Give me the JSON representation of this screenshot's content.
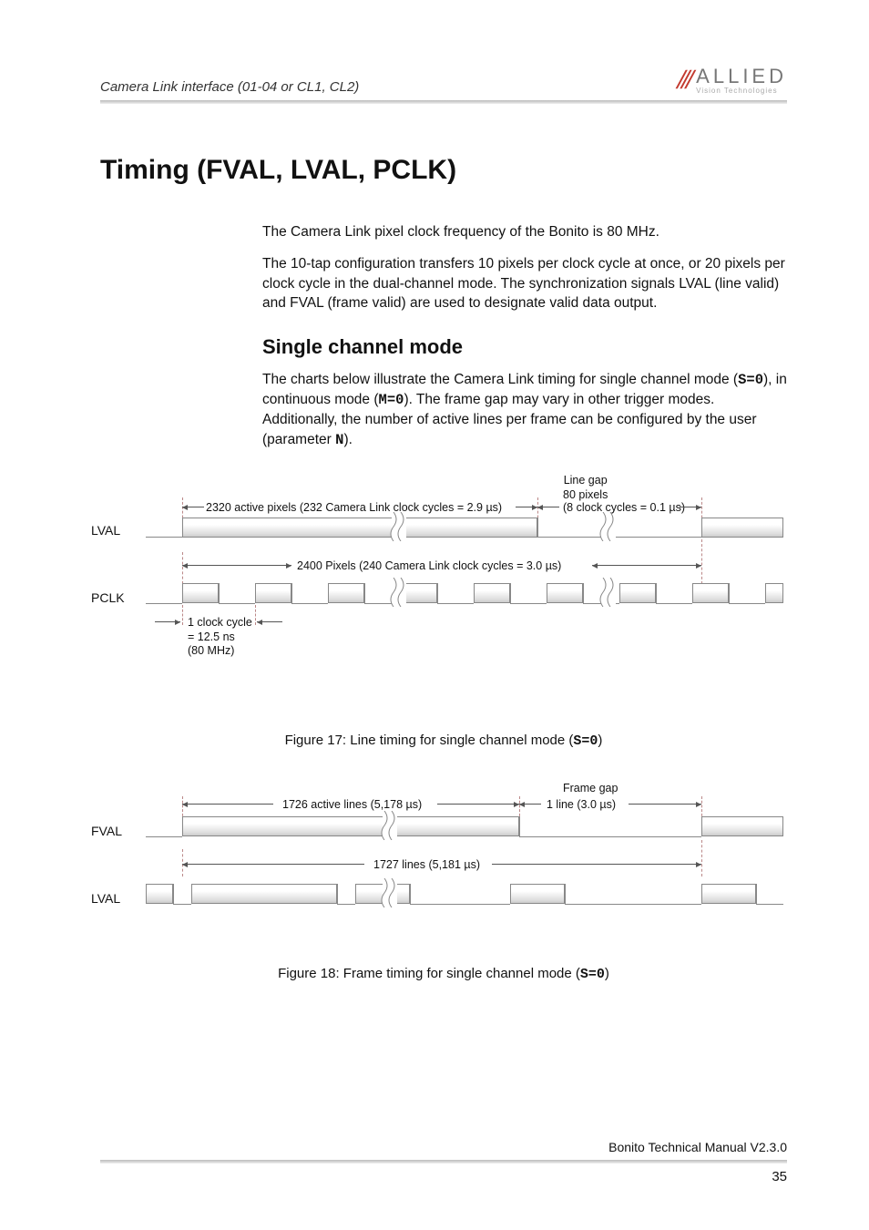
{
  "header": {
    "section_title": "Camera Link interface (01-04 or CL1, CL2)",
    "logo_main": "ALLIED",
    "logo_sub": "Vision Technologies"
  },
  "h1": "Timing (FVAL, LVAL, PCLK)",
  "para1": "The Camera Link pixel clock frequency of the Bonito is 80 MHz.",
  "para2": "The 10-tap configuration transfers 10 pixels per clock cycle at once, or 20 pixels per clock cycle in the dual-channel mode. The synchronization signals LVAL (line valid) and FVAL (frame valid) are used to designate valid data output.",
  "h2": "Single channel mode",
  "para3_a": "The charts below illustrate the Camera Link timing for single channel mode (",
  "para3_s0": "S=0",
  "para3_b": "), in continuous mode (",
  "para3_m0": "M=0",
  "para3_c": "). The frame gap may vary in other trigger modes. Additionally, the number of active lines per frame can be configured by the user (parameter ",
  "para3_n": " N",
  "para3_d": ").",
  "fig17": {
    "lval_label": "LVAL",
    "pclk_label": "PCLK",
    "active_pixels": "2320 active pixels (232 Camera Link clock cycles = 2.9 µs)",
    "line_gap_top": "Line gap",
    "line_gap_mid": "80 pixels",
    "line_gap_bot": "(8 clock cycles = 0.1 µs)",
    "total_pixels": "2400 Pixels (240 Camera Link clock cycles = 3.0 µs)",
    "clock_cycle_a": "1 clock cycle",
    "clock_cycle_b": "= 12.5 ns",
    "clock_cycle_c": "(80 MHz)",
    "caption_a": "Figure 17: Line timing for single channel mode (",
    "caption_code": "S=0",
    "caption_b": ")"
  },
  "fig18": {
    "fval_label": "FVAL",
    "lval_label": "LVAL",
    "active_lines": "1726 active lines (5,178 µs)",
    "frame_gap_top": "Frame gap",
    "frame_gap_bot": "1 line (3.0 µs)",
    "total_lines": "1727 lines (5,181 µs)",
    "caption_a": "Figure 18: Frame timing for single channel mode (",
    "caption_code": "S=0",
    "caption_b": ")"
  },
  "footer": {
    "manual": "Bonito Technical Manual V2.3.0",
    "page": "35"
  },
  "chart_data": [
    {
      "type": "timing-diagram",
      "title": "Line timing for single channel mode (S=0)",
      "signals": [
        "LVAL",
        "PCLK"
      ],
      "clock_frequency_MHz": 80,
      "clock_period_ns": 12.5,
      "active_pixels_per_line": 2320,
      "active_clock_cycles": 232,
      "active_duration_us": 2.9,
      "line_gap_pixels": 80,
      "line_gap_clock_cycles": 8,
      "line_gap_duration_us": 0.1,
      "total_pixels_per_line": 2400,
      "total_clock_cycles": 240,
      "total_line_duration_us": 3.0
    },
    {
      "type": "timing-diagram",
      "title": "Frame timing for single channel mode (S=0)",
      "signals": [
        "FVAL",
        "LVAL"
      ],
      "active_lines_per_frame": 1726,
      "active_duration_us": 5178,
      "frame_gap_lines": 1,
      "frame_gap_duration_us": 3.0,
      "total_lines_per_frame": 1727,
      "total_frame_duration_us": 5181
    }
  ]
}
